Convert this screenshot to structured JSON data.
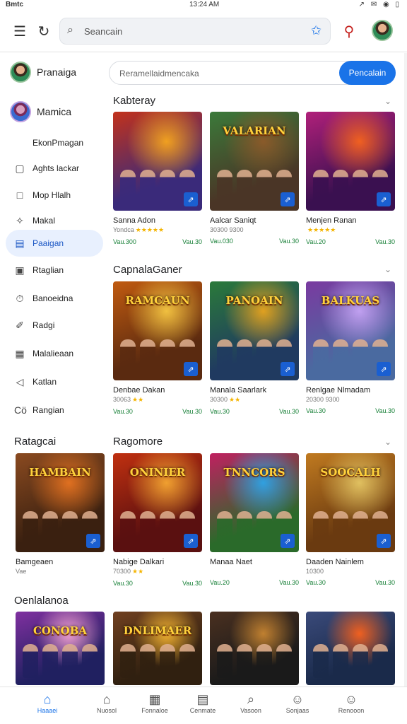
{
  "status": {
    "left": "Bmtc",
    "center": "13:24 AM",
    "right": "↗ ✉ ◉ ▯"
  },
  "topbar": {
    "search_placeholder": "Seancain"
  },
  "search2": {
    "placeholder": "Reramellaidmencaka",
    "button": "Pencalain"
  },
  "sidebar": {
    "profile1": "Pranaiga",
    "profile2": "Mamica",
    "items": [
      {
        "label": "EkonPmagan",
        "icon": ""
      },
      {
        "label": "Aghts lackar",
        "icon": "▢"
      },
      {
        "label": "Mop Hlalh",
        "icon": "□"
      },
      {
        "label": "Makal",
        "icon": "✧"
      },
      {
        "label": "Paaigan",
        "icon": "▤"
      },
      {
        "label": "Rtaglian",
        "icon": "▣"
      },
      {
        "label": "Banoeidna",
        "icon": "⏱"
      },
      {
        "label": "Radgi",
        "icon": "✐"
      },
      {
        "label": "Malalieaan",
        "icon": "▦"
      },
      {
        "label": "Katlan",
        "icon": "◁"
      },
      {
        "label": "Rangian",
        "icon": "Cö"
      }
    ]
  },
  "sections": [
    {
      "title": "Kabteray"
    },
    {
      "title": "CapnalaGaner"
    },
    {
      "title": "Ragomore"
    },
    {
      "title": "Ratagcai"
    },
    {
      "title": "Oenlalanoa"
    }
  ],
  "cards": [
    {
      "name": "Sanna Adon",
      "meta": "Yondca",
      "stars": "★★★★★",
      "p1": "Vau.300",
      "p2": "Vau.30",
      "title": "",
      "badge": "⇗",
      "colors": [
        "#3a2a7a",
        "#c2321c",
        "#f0a020"
      ]
    },
    {
      "name": "Aalcar Saniqt",
      "meta": "30300 9300",
      "stars": "",
      "p1": "Vau.030",
      "p2": "Vau.30",
      "title": "VALARIAN",
      "badge": "⇗",
      "colors": [
        "#4a3526",
        "#3b7a3a",
        "#8a5a2a"
      ]
    },
    {
      "name": "Menjen Ranan",
      "meta": "",
      "stars": "★★★★★",
      "p1": "Vau.20",
      "p2": "Vau.30",
      "title": "",
      "badge": "⇗",
      "colors": [
        "#3a1050",
        "#b0207a",
        "#f06020"
      ]
    },
    {
      "name": "Denbae Dakan",
      "meta": "30063",
      "stars": "★★",
      "p1": "Vau.30",
      "p2": "Vau.30",
      "title": "RAMCAUN",
      "badge": "⇗",
      "colors": [
        "#5a2a10",
        "#c05a10",
        "#f0c040"
      ]
    },
    {
      "name": "Manala Saarlark",
      "meta": "30300",
      "stars": "★★",
      "p1": "Vau.30",
      "p2": "Vau.30",
      "title": "PANOAIN",
      "badge": "⇗",
      "colors": [
        "#203a60",
        "#2a7a3a",
        "#e0a020"
      ]
    },
    {
      "name": "Renlgae Nlmadam",
      "meta": "20300 9300",
      "stars": "",
      "p1": "Vau.30",
      "p2": "Vau.30",
      "title": "BALKUAS",
      "badge": "⇗",
      "colors": [
        "#4a6aa0",
        "#7a3aa0",
        "#c0a0f0"
      ]
    },
    {
      "name": "Bamgeaen",
      "meta": "Vae",
      "stars": "",
      "p1": "",
      "p2": "",
      "title": "HAMBAIN",
      "badge": "⇗",
      "colors": [
        "#3a2010",
        "#8a4a20",
        "#e07020"
      ]
    },
    {
      "name": "Nabige Dalkari",
      "meta": "70300",
      "stars": "★★",
      "p1": "Vau.30",
      "p2": "Vau.30",
      "title": "ONINIER",
      "badge": "⇗",
      "colors": [
        "#5a1010",
        "#c03010",
        "#f0a030"
      ]
    },
    {
      "name": "Manaa Naet",
      "meta": "",
      "stars": "",
      "p1": "Vau.20",
      "p2": "Vau.30",
      "title": "TNNCORS",
      "badge": "⇗",
      "colors": [
        "#2a6a2a",
        "#c02060",
        "#30a0e0"
      ]
    },
    {
      "name": "Daaden Nainlem",
      "meta": "10300",
      "stars": "",
      "p1": "Vau.30",
      "p2": "Vau.30",
      "title": "SOOCALH",
      "badge": "⇗",
      "colors": [
        "#6a3a10",
        "#c07a20",
        "#e0c060"
      ]
    },
    {
      "name": "",
      "meta": "",
      "stars": "",
      "p1": "",
      "p2": "",
      "title": "CONOBA",
      "badge": "",
      "colors": [
        "#202060",
        "#8030a0",
        "#f0a0d0"
      ]
    },
    {
      "name": "",
      "meta": "",
      "stars": "",
      "p1": "",
      "p2": "",
      "title": "DNLIMAER",
      "badge": "",
      "colors": [
        "#302010",
        "#704020",
        "#f0b030"
      ]
    },
    {
      "name": "",
      "meta": "",
      "stars": "",
      "p1": "",
      "p2": "",
      "title": "",
      "badge": "",
      "colors": [
        "#1a1a1a",
        "#4a3020",
        "#c08030"
      ]
    },
    {
      "name": "",
      "meta": "",
      "stars": "",
      "p1": "",
      "p2": "",
      "title": "",
      "badge": "",
      "colors": [
        "#1a2a4a",
        "#3a4a7a",
        "#f06020"
      ]
    }
  ],
  "bottomnav": [
    {
      "label": "Haaaei",
      "icon": "⌂"
    },
    {
      "label": "Nuosol",
      "icon": "⌂"
    },
    {
      "label": "Fonnaloe",
      "icon": "▦"
    },
    {
      "label": "Cenmate",
      "icon": "▤"
    },
    {
      "label": "Vasoon",
      "icon": "⌕"
    },
    {
      "label": "Sonjaas",
      "icon": "☺"
    },
    {
      "label": "Renooon",
      "icon": "☺"
    }
  ]
}
